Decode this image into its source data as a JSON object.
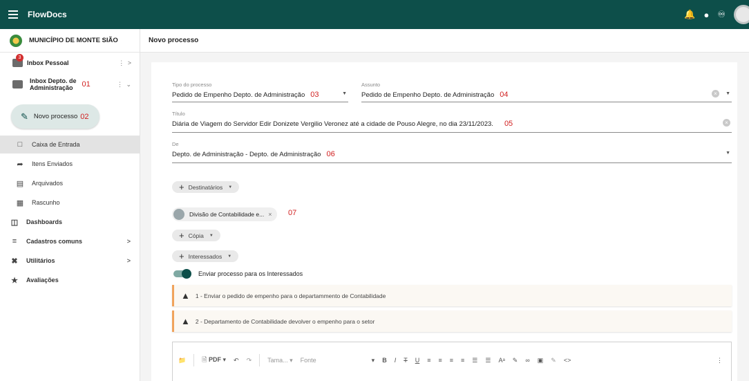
{
  "app": {
    "title": "FlowDocs"
  },
  "topbar": {
    "icons": [
      "bell-icon",
      "account-icon",
      "accessibility-icon",
      "avatar"
    ]
  },
  "sidebar": {
    "org": "MUNICÍPIO DE MONTE SIÃO",
    "inbox_pessoal": {
      "label": "Inbox Pessoal",
      "badge": "3",
      "trailing": "⋮ >"
    },
    "inbox_depto": {
      "label_line1": "Inbox Depto. de",
      "label_line2": "Administração",
      "annotation": "01",
      "trailing": "⋮ ⌄"
    },
    "new_button": {
      "label": "Novo processo",
      "annotation": "02"
    },
    "items": [
      {
        "label": "Caixa de Entrada",
        "icon": "inbox-icon",
        "active": true
      },
      {
        "label": "Itens Enviados",
        "icon": "forward-icon"
      },
      {
        "label": "Arquivados",
        "icon": "archive-icon"
      },
      {
        "label": "Rascunho",
        "icon": "draft-icon"
      }
    ],
    "sections": [
      {
        "label": "Dashboards",
        "icon": "dashboard-icon",
        "arrow": ""
      },
      {
        "label": "Cadastros comuns",
        "icon": "list-icon",
        "arrow": ">"
      },
      {
        "label": "Utilitários",
        "icon": "tools-icon",
        "arrow": ">"
      },
      {
        "label": "Avaliações",
        "icon": "star-icon",
        "arrow": ""
      }
    ]
  },
  "page": {
    "title": "Novo processo"
  },
  "form": {
    "tipo": {
      "label": "Tipo do processo",
      "value": "Pedido de Empenho Depto. de Administração",
      "annotation": "03"
    },
    "assunto": {
      "label": "Assunto",
      "value": "Pedido de Empenho Depto. de Administração",
      "annotation": "04"
    },
    "titulo": {
      "label": "Título",
      "value": "Diária de Viagem do Servidor Edir Donizete Vergilio Veronez até a cidade de Pouso Alegre, no dia 23/11/2023.",
      "annotation": "05"
    },
    "de": {
      "label": "De",
      "value": "Depto. de Administração - Depto. de Administração",
      "annotation": "06"
    },
    "destinatarios": {
      "label": "Destinatários"
    },
    "chip": {
      "label": "Divisão de Contabilidade e...",
      "annotation": "07"
    },
    "copia": {
      "label": "Cópia"
    },
    "interessados": {
      "label": "Interessados"
    },
    "toggle": {
      "label": "Enviar processo para os Interessados",
      "on": true
    },
    "warnings": [
      "1 - Enviar o pedido de empenho para o departammento de Contabilidade",
      "2 - Departamento de Contabilidade devolver o empenho para o setor"
    ]
  },
  "editor": {
    "pdf": "PDF",
    "size_placeholder": "Tama...",
    "font_placeholder": "Fonte"
  },
  "colors": {
    "primary": "#0d4f4a",
    "annotation": "#d11f1f",
    "warning": "#f0a35c"
  }
}
